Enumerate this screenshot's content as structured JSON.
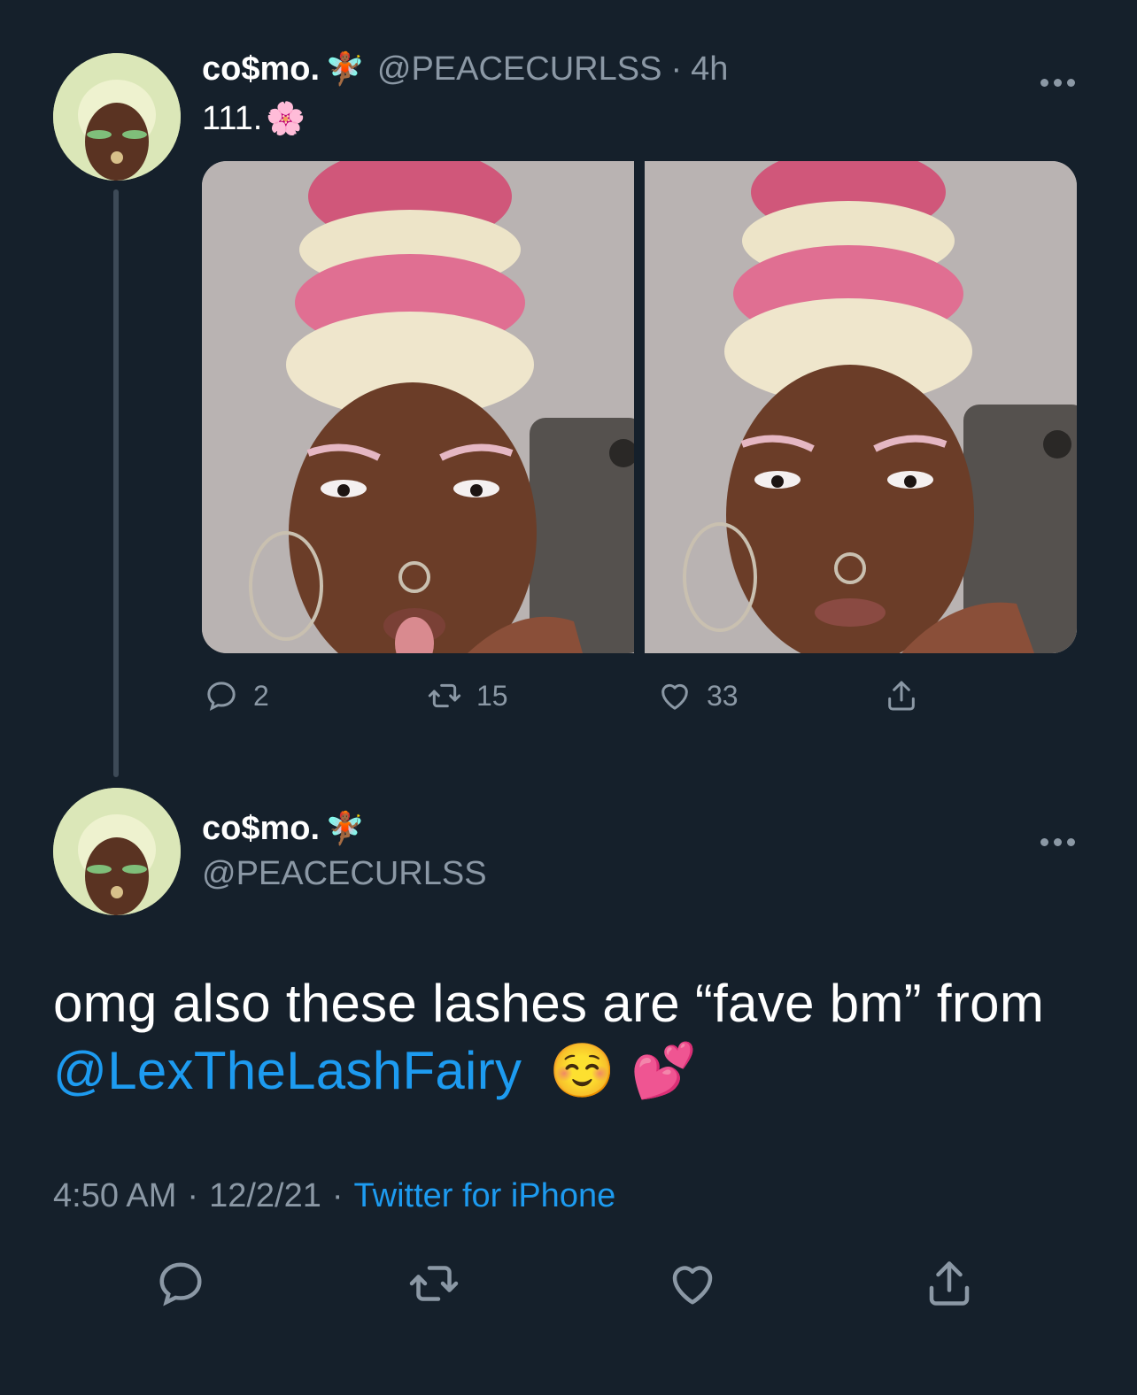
{
  "first_tweet": {
    "display_name": "co$mo.",
    "name_emoji": "🧚🏾",
    "handle": "@PEACECURLSS",
    "separator": "·",
    "age": "4h",
    "text": "111.",
    "text_emoji": "🌸",
    "more_icon": "more-horizontal-icon",
    "actions": {
      "reply_count": "2",
      "retweet_count": "15",
      "like_count": "33"
    }
  },
  "reply_tweet": {
    "display_name": "co$mo.",
    "name_emoji": "🧚🏾",
    "handle": "@PEACECURLSS",
    "text": "omg also these lashes are “fave bm” from",
    "mention": "@LexTheLashFairy",
    "trailing_emoji": "☺️ 💕",
    "time": "4:50 AM",
    "separator": "·",
    "date": "12/2/21",
    "source": "Twitter for iPhone"
  },
  "colors": {
    "background": "#15202b",
    "accent": "#1d9bf0",
    "secondary_text": "#8b98a5"
  }
}
